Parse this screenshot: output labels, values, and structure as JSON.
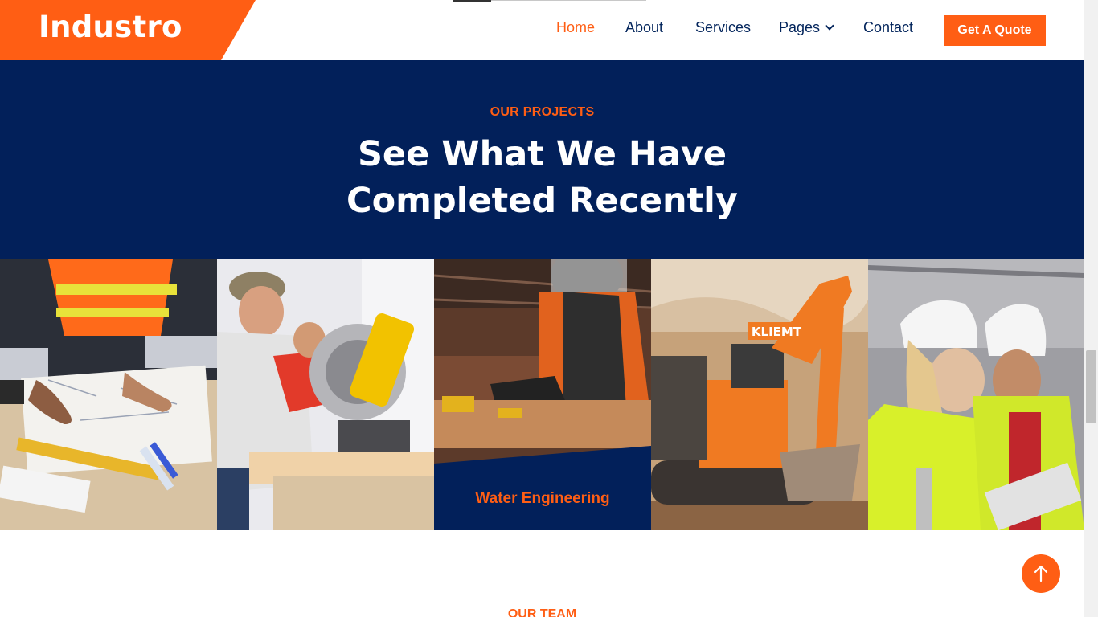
{
  "brand": {
    "name": "Industro"
  },
  "nav": {
    "items": [
      {
        "label": "Home",
        "active": true
      },
      {
        "label": "About"
      },
      {
        "label": "Services"
      },
      {
        "label": "Pages",
        "dropdown": true
      },
      {
        "label": "Contact"
      }
    ],
    "cta": "Get A Quote"
  },
  "projects": {
    "eyebrow": "OUR PROJECTS",
    "heading_line1": "See What We Have",
    "heading_line2": "Completed Recently",
    "tiles": [
      {
        "icon": "architect-drawing-photo"
      },
      {
        "icon": "miter-saw-photo"
      },
      {
        "icon": "welder-photo",
        "caption": "Water Engineering"
      },
      {
        "icon": "excavator-photo",
        "machine_label": "KLIEMT"
      },
      {
        "icon": "engineers-tablet-photo"
      }
    ]
  },
  "team": {
    "eyebrow": "OUR TEAM"
  },
  "colors": {
    "accent": "#ff5e14",
    "navy": "#02205a",
    "nav_text": "#02245b"
  }
}
